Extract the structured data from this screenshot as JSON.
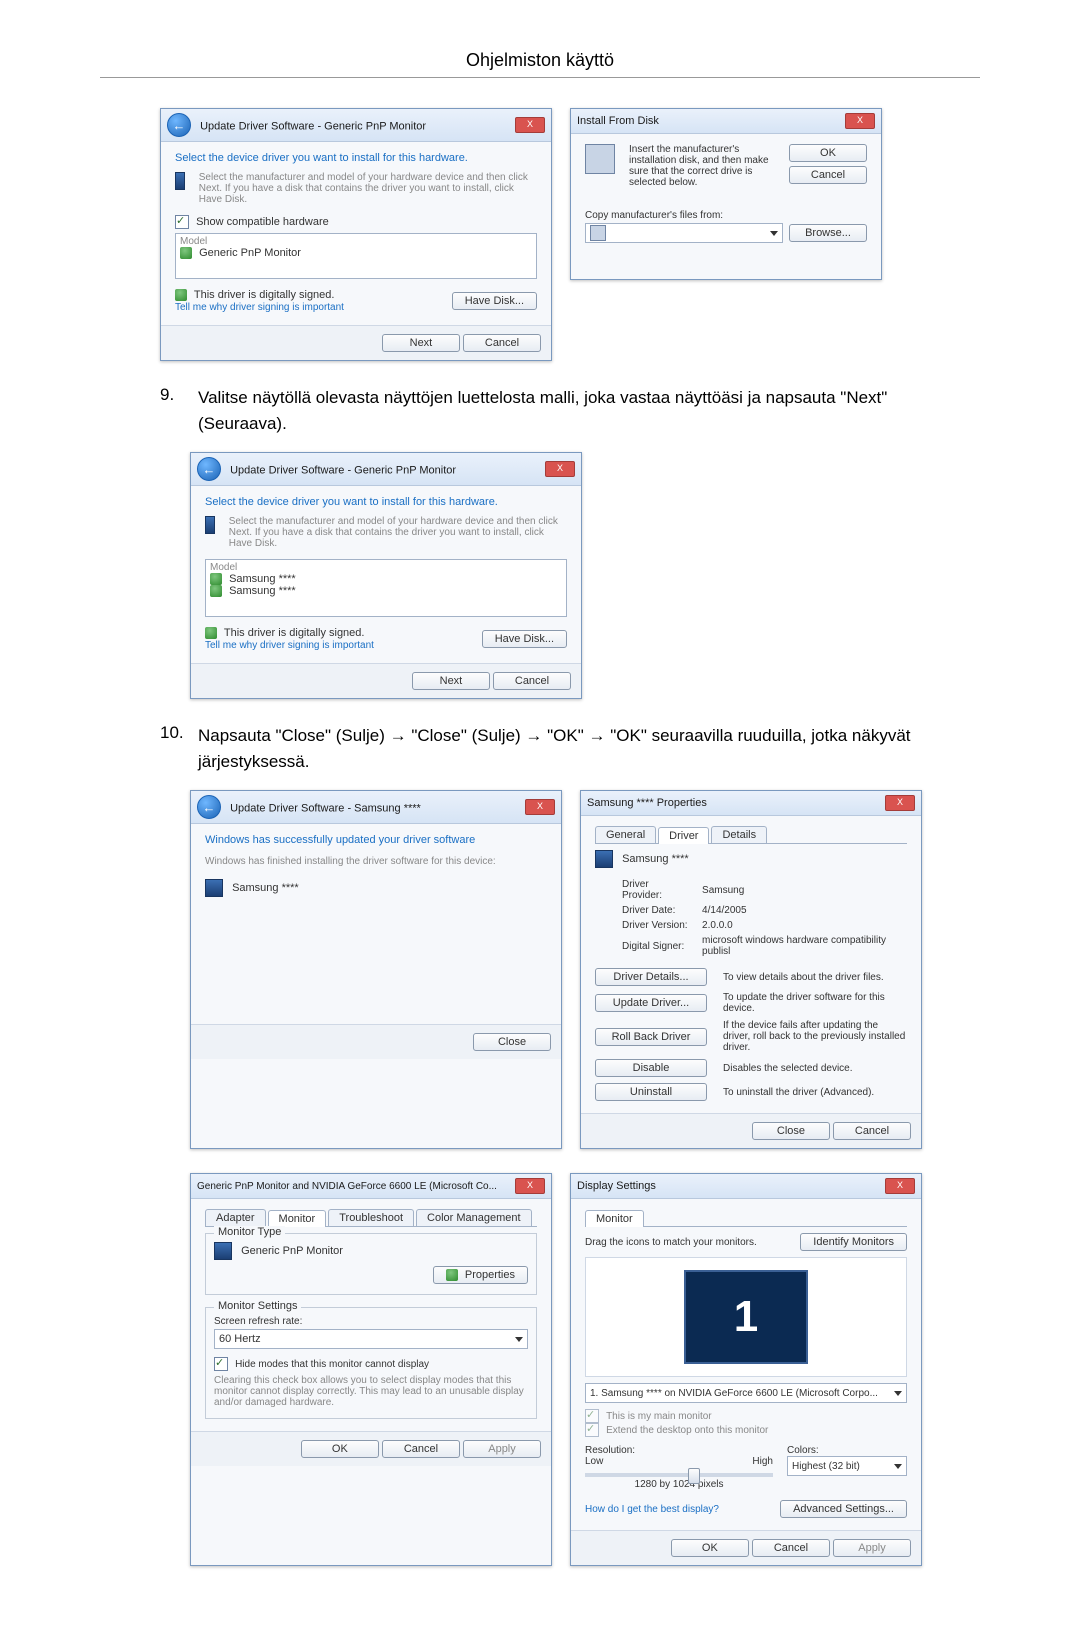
{
  "page_title": "Ohjelmiston käyttö",
  "step9": {
    "num": "9.",
    "text": "Valitse näytöllä olevasta näyttöjen luettelosta malli, joka vastaa näyttöäsi ja napsauta \"Next\" (Seuraava)."
  },
  "step10": {
    "num": "10.",
    "text": "Napsauta \"Close\" (Sulje) → \"Close\" (Sulje) → \"OK\" → \"OK\" seuraavilla ruuduilla, jotka näkyvät järjestyksessä."
  },
  "update_driver_a": {
    "breadcrumb": "Update Driver Software - Generic PnP Monitor",
    "heading": "Select the device driver you want to install for this hardware.",
    "subtext": "Select the manufacturer and model of your hardware device and then click Next. If you have a disk that contains the driver you want to install, click Have Disk.",
    "show_compatible": "Show compatible hardware",
    "model_label": "Model",
    "model_item": "Generic PnP Monitor",
    "signed": "This driver is digitally signed.",
    "tell_me": "Tell me why driver signing is important",
    "have_disk": "Have Disk...",
    "next": "Next",
    "cancel": "Cancel"
  },
  "install_from_disk": {
    "title": "Install From Disk",
    "instruction": "Insert the manufacturer's installation disk, and then make sure that the correct drive is selected below.",
    "ok": "OK",
    "cancel": "Cancel",
    "copy_from": "Copy manufacturer's files from:",
    "browse": "Browse..."
  },
  "update_driver_b": {
    "breadcrumb": "Update Driver Software - Generic PnP Monitor",
    "heading": "Select the device driver you want to install for this hardware.",
    "subtext": "Select the manufacturer and model of your hardware device and then click Next. If you have a disk that contains the driver you want to install, click Have Disk.",
    "model_label": "Model",
    "model_item1": "Samsung ****",
    "model_item2": "Samsung ****",
    "signed": "This driver is digitally signed.",
    "tell_me": "Tell me why driver signing is important",
    "have_disk": "Have Disk...",
    "next": "Next",
    "cancel": "Cancel"
  },
  "update_driver_done": {
    "breadcrumb": "Update Driver Software - Samsung ****",
    "heading": "Windows has successfully updated your driver software",
    "subtext": "Windows has finished installing the driver software for this device:",
    "device": "Samsung ****",
    "close": "Close"
  },
  "driver_props": {
    "title": "Samsung **** Properties",
    "tab_general": "General",
    "tab_driver": "Driver",
    "tab_details": "Details",
    "device": "Samsung ****",
    "provider_label": "Driver Provider:",
    "provider_value": "Samsung",
    "date_label": "Driver Date:",
    "date_value": "4/14/2005",
    "version_label": "Driver Version:",
    "version_value": "2.0.0.0",
    "signer_label": "Digital Signer:",
    "signer_value": "microsoft windows hardware compatibility publisl",
    "btn_details": "Driver Details...",
    "txt_details": "To view details about the driver files.",
    "btn_update": "Update Driver...",
    "txt_update": "To update the driver software for this device.",
    "btn_rollback": "Roll Back Driver",
    "txt_rollback": "If the device fails after updating the driver, roll back to the previously installed driver.",
    "btn_disable": "Disable",
    "txt_disable": "Disables the selected device.",
    "btn_uninstall": "Uninstall",
    "txt_uninstall": "To uninstall the driver (Advanced).",
    "close": "Close",
    "cancel": "Cancel"
  },
  "adapter_props": {
    "title": "Generic PnP Monitor and NVIDIA GeForce 6600 LE (Microsoft Co...",
    "tab_adapter": "Adapter",
    "tab_monitor": "Monitor",
    "tab_troubleshoot": "Troubleshoot",
    "tab_color": "Color Management",
    "monitor_type_label": "Monitor Type",
    "monitor_type_value": "Generic PnP Monitor",
    "properties_btn": "Properties",
    "monitor_settings_label": "Monitor Settings",
    "refresh_label": "Screen refresh rate:",
    "refresh_value": "60 Hertz",
    "hide_modes": "Hide modes that this monitor cannot display",
    "hide_modes_desc": "Clearing this check box allows you to select display modes that this monitor cannot display correctly. This may lead to an unusable display and/or damaged hardware.",
    "ok": "OK",
    "cancel": "Cancel",
    "apply": "Apply"
  },
  "display_settings": {
    "title": "Display Settings",
    "tab_monitor": "Monitor",
    "drag_text": "Drag the icons to match your monitors.",
    "identify": "Identify Monitors",
    "monitor_number": "1",
    "monitor_select": "1. Samsung **** on NVIDIA GeForce 6600 LE (Microsoft Corpo...",
    "this_is_main": "This is my main monitor",
    "extend": "Extend the desktop onto this monitor",
    "resolution_label": "Resolution:",
    "low": "Low",
    "high": "High",
    "res_value": "1280 by 1024 pixels",
    "colors_label": "Colors:",
    "colors_value": "Highest (32 bit)",
    "best_display": "How do I get the best display?",
    "advanced": "Advanced Settings...",
    "ok": "OK",
    "cancel": "Cancel",
    "apply": "Apply"
  }
}
